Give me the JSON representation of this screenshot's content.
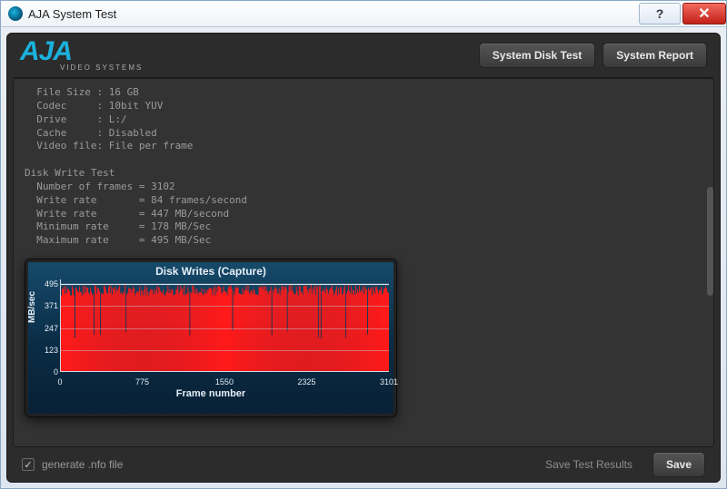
{
  "window": {
    "title": "AJA System Test"
  },
  "brand": {
    "name": "AJA",
    "tagline": "VIDEO SYSTEMS"
  },
  "toolbar": {
    "disk_test": "System Disk Test",
    "system_report": "System Report"
  },
  "readout": {
    "lines": [
      {
        "label": "File Size ",
        "sep": ": ",
        "value": "16 GB"
      },
      {
        "label": "Codec     ",
        "sep": ": ",
        "value": "10bit YUV"
      },
      {
        "label": "Drive     ",
        "sep": ": ",
        "value": "L:/"
      },
      {
        "label": "Cache     ",
        "sep": ": ",
        "value": "Disabled"
      },
      {
        "label": "Video file",
        "sep": ": ",
        "value": "File per frame"
      }
    ],
    "section_title": "Disk Write Test",
    "metrics": [
      {
        "label": "Number of frames",
        "value": "3102",
        "unit": ""
      },
      {
        "label": "Write rate      ",
        "value": "84",
        "unit": " frames/second"
      },
      {
        "label": "Write rate      ",
        "value": "447",
        "unit": " MB/second"
      },
      {
        "label": "Minimum rate    ",
        "value": "178",
        "unit": " MB/Sec"
      },
      {
        "label": "Maximum rate    ",
        "value": "495",
        "unit": " MB/Sec"
      }
    ]
  },
  "chart_data": {
    "type": "bar",
    "title": "Disk Writes (Capture)",
    "xlabel": "Frame number",
    "ylabel": "MB/sec",
    "yticks": [
      0,
      123,
      247,
      371,
      495
    ],
    "xticks": [
      0,
      775,
      1550,
      2325,
      3101
    ],
    "ylim": [
      0,
      520
    ],
    "x_range": [
      0,
      3101
    ],
    "series": [
      {
        "name": "write-rate",
        "color": "#ff1a1a",
        "summary": {
          "typical": 447,
          "min": 178,
          "max": 495,
          "n_frames": 3102
        }
      }
    ]
  },
  "footer": {
    "generate_nfo": "generate .nfo file",
    "generate_nfo_checked": true,
    "save_results_label": "Save Test Results",
    "save_button": "Save"
  }
}
